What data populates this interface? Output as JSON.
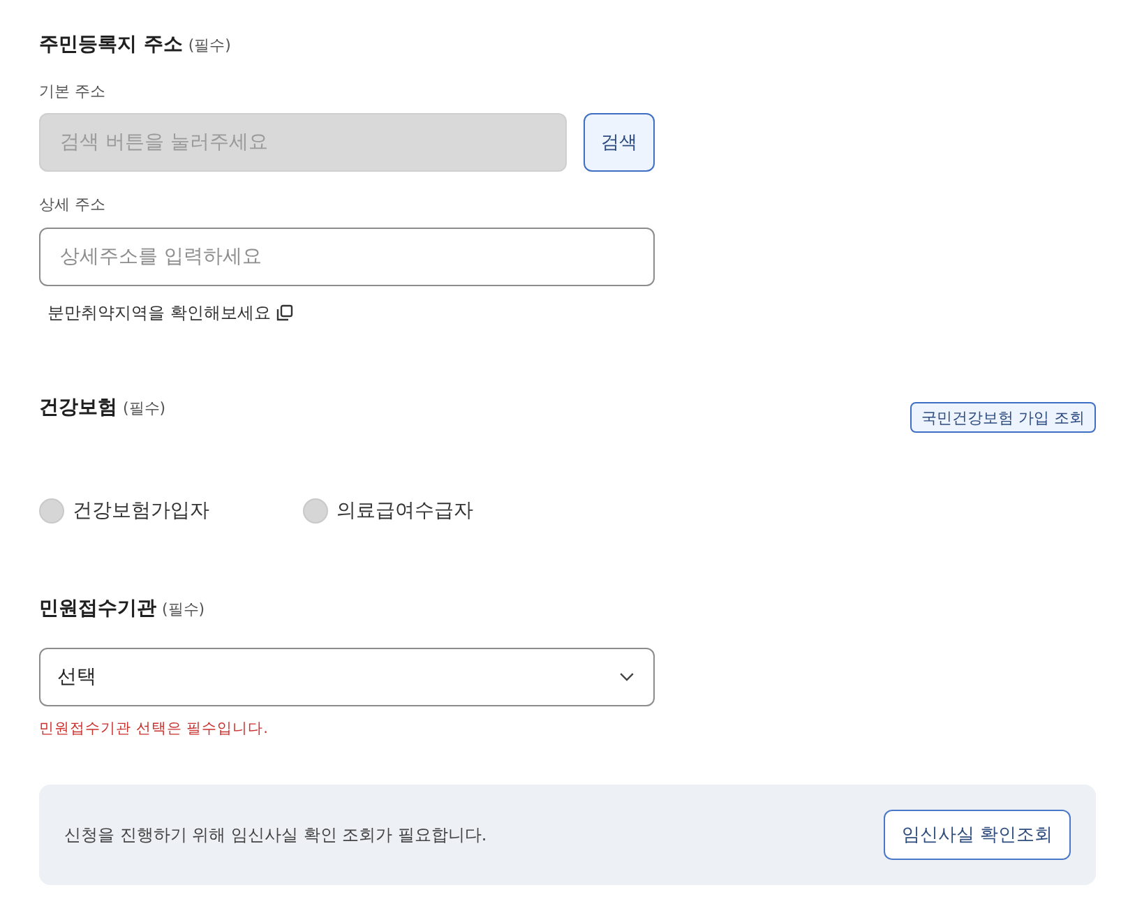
{
  "address": {
    "title": "주민등록지 주소",
    "required": "(필수)",
    "basic": {
      "label": "기본 주소",
      "placeholder": "검색 버튼을 눌러주세요",
      "disabled": true,
      "button": "검색"
    },
    "detail": {
      "label": "상세 주소",
      "placeholder": "상세주소를 입력하세요"
    },
    "link": "분만취약지역을 확인해보세요"
  },
  "insurance": {
    "title": "건강보험",
    "required": "(필수)",
    "button": "국민건강보험 가입 조회",
    "options": [
      {
        "label": "건강보험가입자",
        "selected": false
      },
      {
        "label": "의료급여수급자",
        "selected": false
      }
    ]
  },
  "agency": {
    "title": "민원접수기관",
    "required": "(필수)",
    "select": {
      "value": "선택"
    },
    "error": "민원접수기관 선택은 필수입니다."
  },
  "notice": {
    "text": "신청을 진행하기 위해 임신사실 확인 조회가 필요합니다.",
    "button": "임신사실 확인조회"
  }
}
